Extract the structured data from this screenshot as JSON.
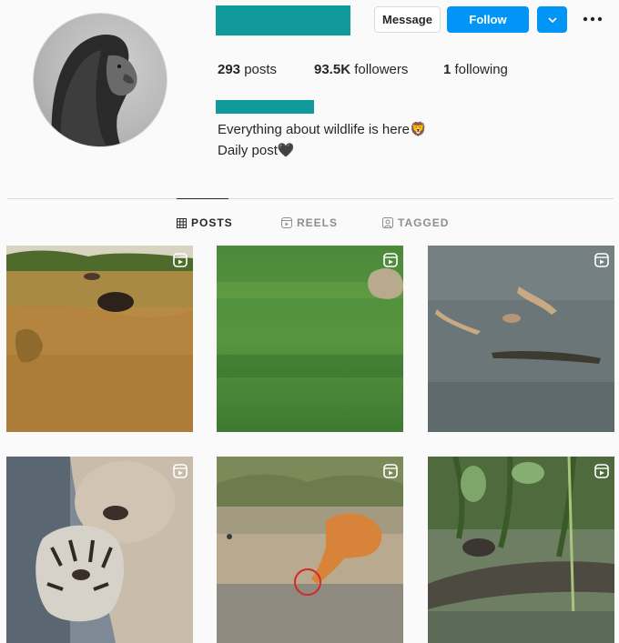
{
  "header": {
    "message_label": "Message",
    "follow_label": "Follow"
  },
  "stats": {
    "posts_count": "293",
    "posts_label": "posts",
    "followers_count": "93.5K",
    "followers_label": "followers",
    "following_count": "1",
    "following_label": "following"
  },
  "bio": {
    "line1": "Everything about wildlife is here🦁",
    "line2": "Daily post🖤"
  },
  "tabs": [
    {
      "label": "POSTS",
      "icon": "grid-icon",
      "active": true
    },
    {
      "label": "REELS",
      "icon": "reels-icon",
      "active": false
    },
    {
      "label": "TAGGED",
      "icon": "tagged-icon",
      "active": false
    }
  ],
  "posts": [
    {
      "subject": "buffalo and lioness in savanna",
      "reel": true
    },
    {
      "subject": "blurred green motion",
      "reel": true
    },
    {
      "subject": "gazelles crossing river with crocodile",
      "reel": true
    },
    {
      "subject": "lioness with tiger cub",
      "reel": true
    },
    {
      "subject": "antelope at waterhole",
      "reel": true
    },
    {
      "subject": "animal on log in swamp",
      "reel": true
    }
  ],
  "colors": {
    "accent": "#0095f6",
    "redaction": "#119a9c",
    "background": "#fafafa"
  }
}
